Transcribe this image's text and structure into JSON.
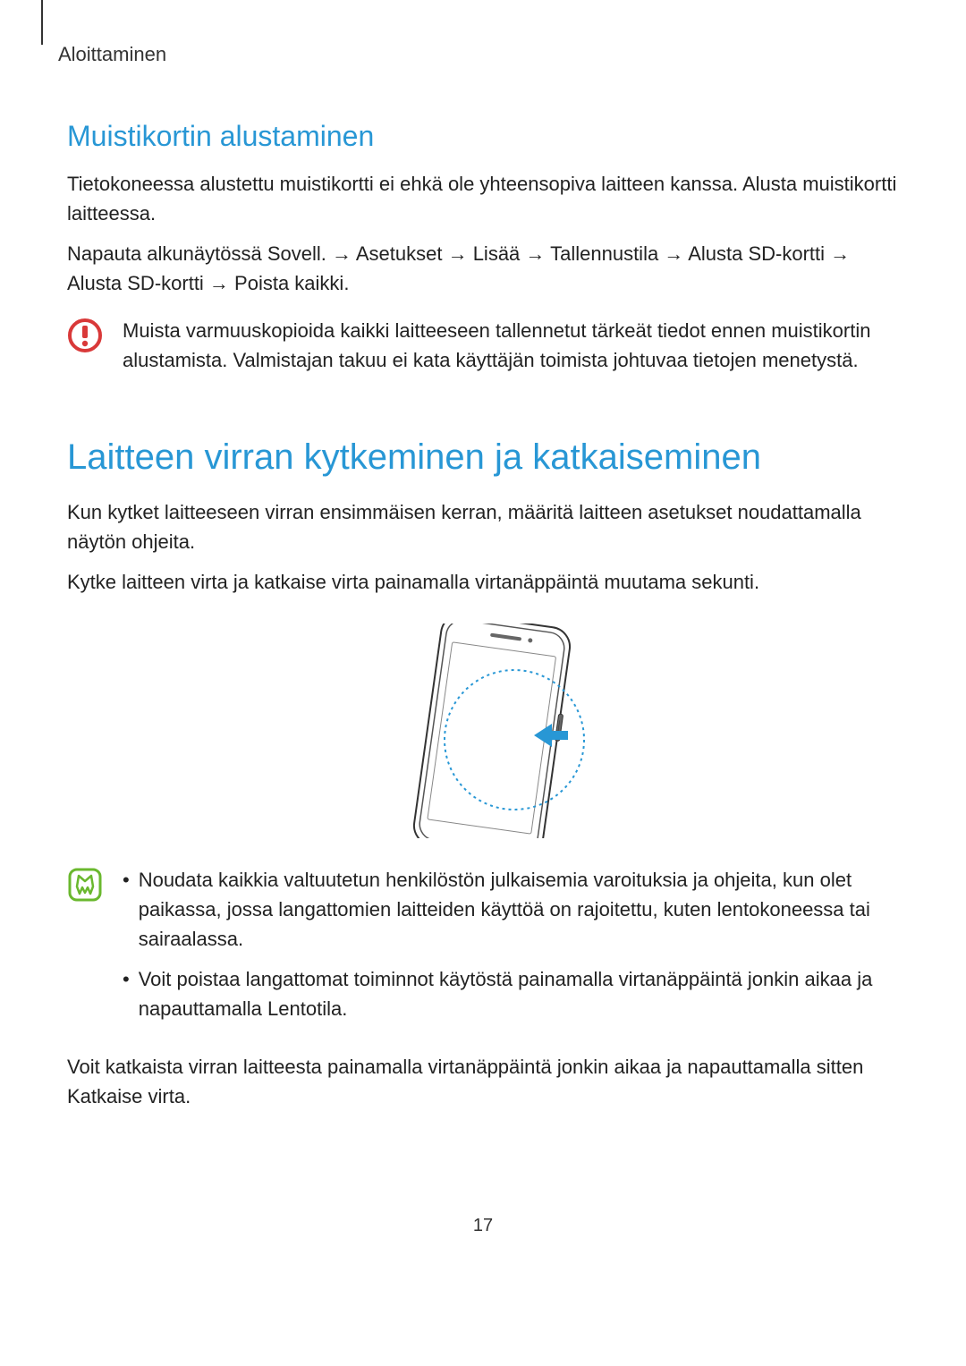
{
  "chapter": "Aloittaminen",
  "section1": {
    "heading": "Muistikortin alustaminen",
    "para1": "Tietokoneessa alustettu muistikortti ei ehkä ole yhteensopiva laitteen kanssa. Alusta muistikortti laitteessa.",
    "nav_path_prefix": "Napauta alkunäytössä ",
    "nav_path": "Sovell. → Asetukset → Lisää → Tallennustila → Alusta SD-kortti → Alusta SD-kortti → Poista kaikki",
    "nav_path_suffix": ".",
    "warning_text": "Muista varmuuskopioida kaikki laitteeseen tallennetut tärkeät tiedot ennen muistikortin alustamista. Valmistajan takuu ei kata käyttäjän toimista johtuvaa tietojen menetystä."
  },
  "section2": {
    "heading": "Laitteen virran kytkeminen ja katkaiseminen",
    "para1": "Kun kytket laitteeseen virran ensimmäisen kerran, määritä laitteen asetukset noudattamalla näytön ohjeita.",
    "para2": "Kytke laitteen virta ja katkaise virta painamalla virtanäppäintä muutama sekunti.",
    "note_bullet1": "Noudata kaikkia valtuutetun henkilöstön julkaisemia varoituksia ja ohjeita, kun olet paikassa, jossa langattomien laitteiden käyttöä on rajoitettu, kuten lentokoneessa tai sairaalassa.",
    "note_bullet2_prefix": "Voit poistaa langattomat toiminnot käytöstä painamalla virtanäppäintä jonkin aikaa ja napauttamalla ",
    "note_bullet2_action": "Lentotila",
    "note_bullet2_suffix": ".",
    "para3_prefix": "Voit katkaista virran laitteesta painamalla virtanäppäintä jonkin aikaa ja napauttamalla sitten ",
    "para3_action": "Katkaise virta",
    "para3_suffix": "."
  },
  "page_number": "17"
}
